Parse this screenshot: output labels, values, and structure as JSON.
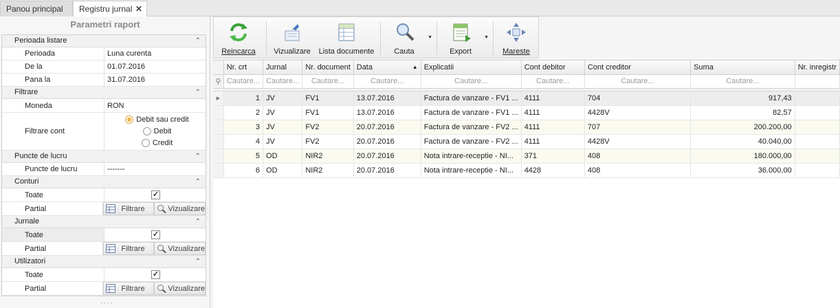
{
  "tabs": [
    {
      "label": "Panou principal"
    },
    {
      "label": "Registru jurnal",
      "close": "✕"
    }
  ],
  "panel": {
    "title": "Parametri raport",
    "sections": {
      "period": {
        "title": "Perioada listare",
        "rows": [
          {
            "key": "Perioada",
            "value": "Luna curenta"
          },
          {
            "key": "De la",
            "value": "01.07.2016"
          },
          {
            "key": "Pana la",
            "value": "31.07.2016"
          }
        ]
      },
      "filter": {
        "title": "Filtrare",
        "moneda_key": "Moneda",
        "moneda_value": "RON",
        "cont_key": "Filtrare cont",
        "radio_options": [
          "Debit sau credit",
          "Debit",
          "Credit"
        ],
        "radio_selected": 0
      },
      "work": {
        "title": "Puncte de lucru",
        "key": "Puncte de lucru",
        "value": "-------"
      },
      "conturi": {
        "title": "Conturi",
        "toate": "Toate",
        "partial": "Partial",
        "checked": true
      },
      "jurnale": {
        "title": "Jurnale",
        "toate": "Toate",
        "partial": "Partial",
        "checked": true
      },
      "utilizatori": {
        "title": "Utilizatori",
        "toate": "Toate",
        "partial": "Partial",
        "checked": true
      }
    },
    "filtrare_btn": "Filtrare",
    "vizualizare_btn": "Vizualizare",
    "check_mark": "✓"
  },
  "toolbar": {
    "reincarca": "Reincarca",
    "vizualizare": "Vizualizare",
    "lista_documente": "Lista documente",
    "cauta": "Cauta",
    "export": "Export",
    "mareste": "Mareste"
  },
  "grid": {
    "columns": [
      "Nr. crt",
      "Jurnal",
      "Nr. document",
      "Data",
      "Explicatii",
      "Cont debitor",
      "Cont creditor",
      "Suma",
      "Nr. inregistr"
    ],
    "filter_placeholders": [
      "Cautare...",
      "Cautare...",
      "Cautare...",
      "Cautare...",
      "Cautare...",
      "Cautare...",
      "Cautare...",
      "Cautare...",
      ""
    ],
    "sort_arrow": "▲",
    "rows": [
      {
        "nr": "1",
        "jurnal": "JV",
        "doc": "FV1",
        "data": "13.07.2016",
        "expl": "Factura de vanzare - FV1 ...",
        "debit": "4111",
        "credit": "704",
        "suma": "917,43"
      },
      {
        "nr": "2",
        "jurnal": "JV",
        "doc": "FV1",
        "data": "13.07.2016",
        "expl": "Factura de vanzare - FV1 ...",
        "debit": "4111",
        "credit": "4428V",
        "suma": "82,57"
      },
      {
        "nr": "3",
        "jurnal": "JV",
        "doc": "FV2",
        "data": "20.07.2016",
        "expl": "Factura de vanzare - FV2 ...",
        "debit": "4111",
        "credit": "707",
        "suma": "200.200,00"
      },
      {
        "nr": "4",
        "jurnal": "JV",
        "doc": "FV2",
        "data": "20.07.2016",
        "expl": "Factura de vanzare - FV2 ...",
        "debit": "4111",
        "credit": "4428V",
        "suma": "40.040,00"
      },
      {
        "nr": "5",
        "jurnal": "OD",
        "doc": "NIR2",
        "data": "20.07.2016",
        "expl": "Nota intrare-receptie - NI...",
        "debit": "371",
        "credit": "408",
        "suma": "180.000,00"
      },
      {
        "nr": "6",
        "jurnal": "OD",
        "doc": "NIR2",
        "data": "20.07.2016",
        "expl": "Nota intrare-receptie - NI...",
        "debit": "4428",
        "credit": "408",
        "suma": "36.000,00"
      }
    ]
  }
}
